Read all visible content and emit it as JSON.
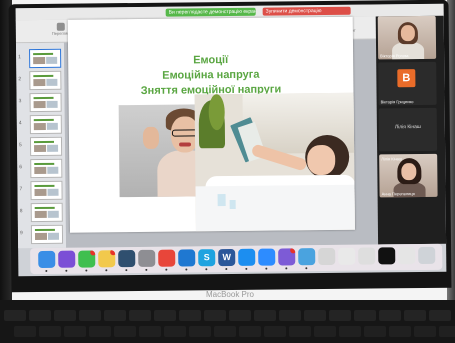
{
  "topbar": {
    "green_text": "Ви переглядаєте демонстрацію екрана",
    "red_text": "Зупинити демонстрацію"
  },
  "toolbar": {
    "tools": [
      "Переглянути",
      "Масштаб",
      "Додати сторінку",
      "Відтворити",
      "Таблиця",
      "Діаграма",
      "Текст",
      "Фігура",
      "Медіа",
      "Коментар",
      "Співпраця",
      "Формат",
      "Анімація",
      "Документ"
    ]
  },
  "navigator": {
    "slide_numbers": [
      "1",
      "2",
      "3",
      "4",
      "5",
      "6",
      "7",
      "8",
      "9"
    ]
  },
  "slide": {
    "title_line1": "Емоції",
    "title_line2": "Емоційна напруга",
    "title_line3": "Зняття емоційної напруги",
    "title_color": "#5aa642"
  },
  "zoom": {
    "participants": [
      {
        "name": "Вікторія Рогова",
        "type": "video"
      },
      {
        "name": "Вікторія Гриценко",
        "type": "avatar",
        "initial": "B",
        "avatar_color": "#ea6c29"
      },
      {
        "name": "Лілія Кінаш",
        "type": "name-only"
      },
      {
        "name": "Анна Перепелиця",
        "type": "video"
      }
    ],
    "name_only_label": "Лілія Кінаш",
    "fourth_tile_top_label": "Лілія Кінаш"
  },
  "dock": {
    "icons": [
      {
        "name": "finder-icon",
        "glyph": "",
        "color": "#3a8ee6"
      },
      {
        "name": "siri-icon",
        "glyph": "",
        "color": "#7b4fd6"
      },
      {
        "name": "facetime-icon",
        "glyph": "",
        "color": "#3fbf4f"
      },
      {
        "name": "notes-icon",
        "glyph": "",
        "color": "#f2c94c"
      },
      {
        "name": "quicktime-icon",
        "glyph": "",
        "color": "#2f4f6f"
      },
      {
        "name": "preview-icon",
        "glyph": "",
        "color": "#8e8e93"
      },
      {
        "name": "chrome-icon",
        "glyph": "",
        "color": "#e8463a"
      },
      {
        "name": "keynote-icon",
        "glyph": "",
        "color": "#1f78d1"
      },
      {
        "name": "skype-icon",
        "glyph": "S",
        "color": "#1fa3e0"
      },
      {
        "name": "word-icon",
        "glyph": "W",
        "color": "#2b579a"
      },
      {
        "name": "safari-icon",
        "glyph": "",
        "color": "#1c8ef0"
      },
      {
        "name": "zoom-icon",
        "glyph": "",
        "color": "#2d8cff"
      },
      {
        "name": "viber-icon",
        "glyph": "",
        "color": "#7d5bd6"
      },
      {
        "name": "desktop-icon",
        "glyph": "",
        "color": "#4aa3df"
      },
      {
        "name": "downloads-folder-icon",
        "glyph": "",
        "color": "#d6d6d6"
      },
      {
        "name": "document-icon",
        "glyph": "",
        "color": "#e9e9e9"
      },
      {
        "name": "document-icon-2",
        "glyph": "",
        "color": "#dedede"
      },
      {
        "name": "screenshot-icon",
        "glyph": "",
        "color": "#111111"
      },
      {
        "name": "document-icon-3",
        "glyph": "",
        "color": "#e5e5e5"
      },
      {
        "name": "trash-icon",
        "glyph": "",
        "color": "#cfd3d8"
      }
    ]
  },
  "device_label": "MacBook Pro"
}
